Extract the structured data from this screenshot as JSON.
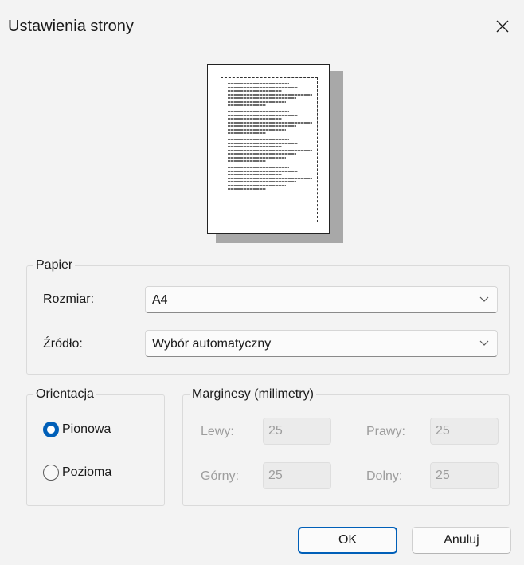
{
  "window": {
    "title": "Ustawienia strony"
  },
  "paper": {
    "legend": "Papier",
    "size_label": "Rozmiar:",
    "size_value": "A4",
    "source_label": "Źródło:",
    "source_value": "Wybór automatyczny"
  },
  "orientation": {
    "legend": "Orientacja",
    "portrait_label": "Pionowa",
    "landscape_label": "Pozioma",
    "selected": "Pionowa"
  },
  "margins": {
    "legend": "Marginesy (milimetry)",
    "left_label": "Lewy:",
    "left_value": "25",
    "right_label": "Prawy:",
    "right_value": "25",
    "top_label": "Górny:",
    "top_value": "25",
    "bottom_label": "Dolny:",
    "bottom_value": "25"
  },
  "buttons": {
    "ok": "OK",
    "cancel": "Anuluj"
  },
  "colors": {
    "accent": "#005fb8",
    "disabled_text": "#9d9d9d",
    "background": "#f3f3f3"
  },
  "icons": {
    "close": "close-icon",
    "dropdown": "chevron-down-icon"
  }
}
